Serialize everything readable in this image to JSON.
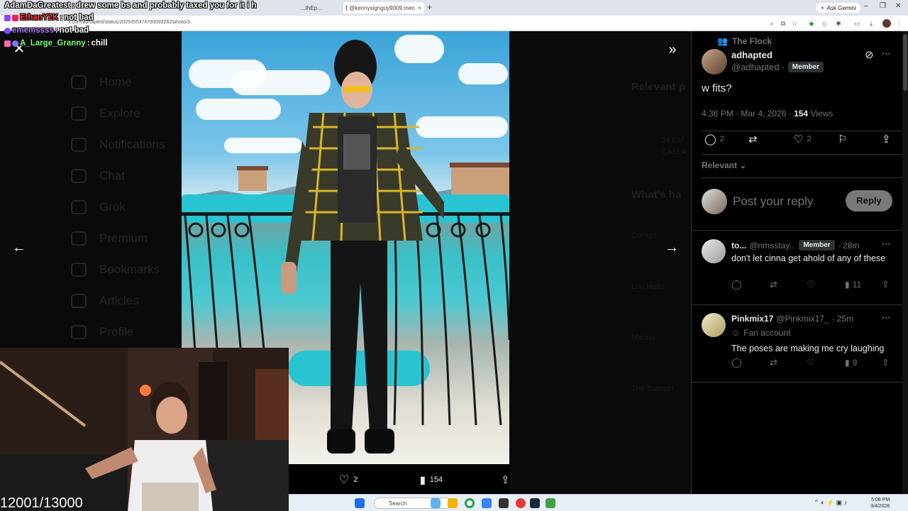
{
  "browser": {
    "tabs": [
      {
        "label": "...thEp..."
      },
      {
        "label": "@kennysignguy9009 men"
      }
    ],
    "url": "x.com/adhapted/status/2029355374793593262/photo/3",
    "gemini_label": "Ask Gemini"
  },
  "background_nav": [
    "Home",
    "Explore",
    "Notifications",
    "Chat",
    "Grok",
    "Premium",
    "Bookmarks",
    "Articles",
    "Profile"
  ],
  "background_right": {
    "relevant": "Relevant p",
    "whats": "What's ha",
    "items": [
      "Cornyn",
      "Lou Holtz",
      "Marino",
      "The Batman"
    ],
    "snippets": [
      "24 EM",
      "CASLA"
    ]
  },
  "chat": [
    {
      "user": "AdamDaGreatest",
      "message": "drew some bs and probably taxed you for it i h",
      "color": "#ffffff"
    },
    {
      "user": "EthanY2K",
      "message": "not bad",
      "color": "#ff4040"
    },
    {
      "user": "ememssss",
      "message": "not bad",
      "color": "#b084ff"
    },
    {
      "user": "A_Large_Granny",
      "message": "chill",
      "color": "#7cff7c"
    }
  ],
  "stream_counter": "12001/13000",
  "photo_actions": {
    "likes": "2",
    "views": "154"
  },
  "post": {
    "community": "The Flock",
    "display_name": "adhapted",
    "handle": "@adhapted",
    "separator": "·",
    "badge": "Member",
    "text": "w fits?",
    "time": "4:36 PM · Mar 4, 2026 ·",
    "views_count": "154",
    "views_label": "Views",
    "replies": "2",
    "likes": "2",
    "sort_label": "Relevant",
    "reply_placeholder": "Post your reply",
    "reply_button": "Reply"
  },
  "replies": [
    {
      "name": "to...",
      "handle": "@nmsstay...",
      "badge": "Member",
      "time": "· 28m",
      "text": "don't let cinna get ahold of any of these",
      "views": "11",
      "sub_badge": ""
    },
    {
      "name": "Pinkmix17",
      "handle": "@Pinkmix17_",
      "badge": "",
      "time": "· 25m",
      "sub_badge": "Fan account",
      "text": "The poses are making me cry laughing",
      "views": "9"
    }
  ],
  "taskbar": {
    "search": "Search",
    "time": "5:08 PM",
    "date": "3/4/2026"
  },
  "colors": {
    "accent": "#1d9bf0",
    "muted": "#71767b",
    "border": "#2f3336",
    "reply_button_bg": "#787a7a"
  }
}
